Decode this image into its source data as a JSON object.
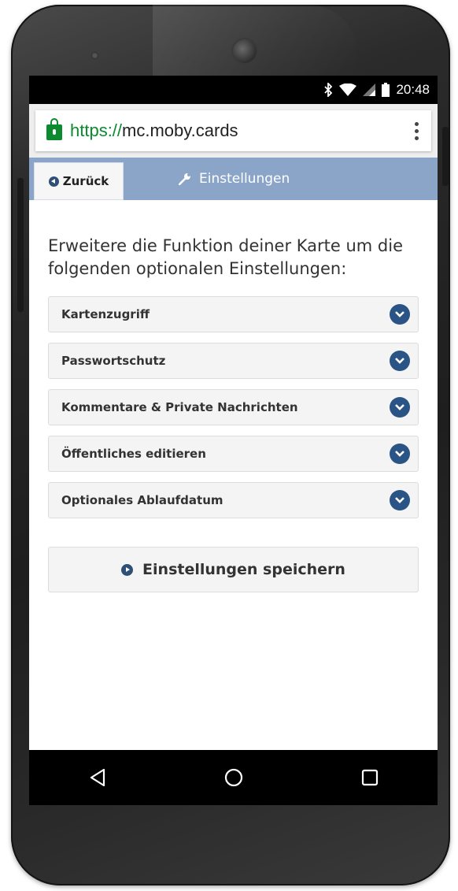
{
  "status_bar": {
    "time": "20:48",
    "icons": [
      "bluetooth-icon",
      "wifi-icon",
      "signal-icon",
      "battery-icon"
    ]
  },
  "browser": {
    "url_scheme": "https://",
    "url_host": "mc.moby.cards",
    "lock_icon": "lock-icon",
    "menu_icon": "overflow-menu-icon",
    "secure_color": "#0b8a2f"
  },
  "nav": {
    "back_label": "Zurück",
    "title": "Einstellungen",
    "bar_color": "#8ba5c9"
  },
  "main": {
    "intro": "Erweitere die Funktion deiner Karte um die folgenden optionalen Einstellungen:",
    "sections": [
      {
        "label": "Kartenzugriff"
      },
      {
        "label": "Passwortschutz"
      },
      {
        "label": "Kommentare & Private Nachrichten"
      },
      {
        "label": "Öffentliches editieren"
      },
      {
        "label": "Optionales Ablaufdatum"
      }
    ],
    "save_label": "Einstellungen speichern",
    "accent_color": "#2a5485"
  },
  "android_nav": {
    "buttons": [
      "back-icon",
      "home-icon",
      "recents-icon"
    ]
  }
}
